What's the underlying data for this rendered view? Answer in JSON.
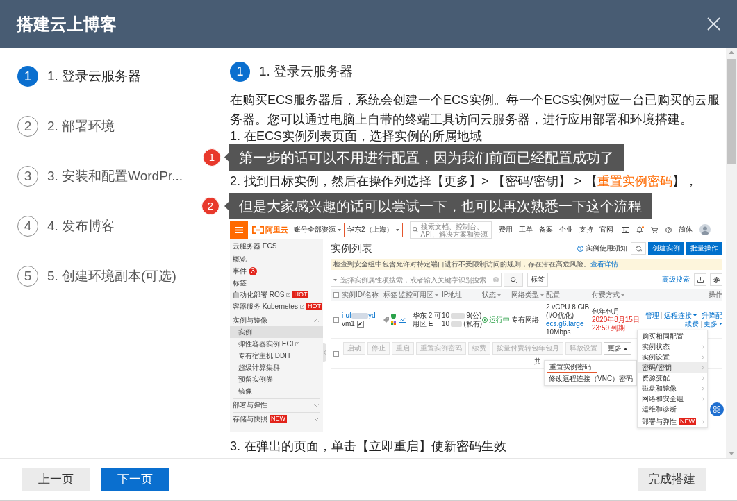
{
  "dialog": {
    "title": "搭建云上博客"
  },
  "steps": [
    {
      "number": "1",
      "label": "1. 登录云服务器",
      "selected": true
    },
    {
      "number": "2",
      "label": "2. 部署环境",
      "selected": false
    },
    {
      "number": "3",
      "label": "3. 安装和配置WordPr...",
      "selected": false
    },
    {
      "number": "4",
      "label": "4. 发布博客",
      "selected": false
    },
    {
      "number": "5",
      "label": "5. 创建环境副本(可选)",
      "selected": false
    }
  ],
  "content": {
    "heading": {
      "number": "1",
      "title": "1. 登录云服务器"
    },
    "intro": "在购买ECS服务器后，系统会创建一个ECS实例。每一个ECS实例对应一台已购买的云服务器。您可以通过电脑上自带的终端工具访问云服务器，进行应用部署和环境搭建。",
    "instructions": [
      {
        "kind": "text",
        "text": "1. 在ECS实例列表页面，选择实例的所属地域"
      },
      {
        "kind": "link",
        "before": "2. 找到目标实例，然后在操作列选择【更多】> 【密码/密钥】 > 【",
        "link": "重置实例密码",
        "after": "】，"
      }
    ],
    "screenshot": {
      "topbar": {
        "logo_text": "阿里云",
        "account_menu": "账号全部资源",
        "region": {
          "label": "华东2（上海）",
          "highlighted": true
        },
        "search_placeholder": "搜索文档、控制台、API、解决方案和资源",
        "links": [
          "费用",
          "工单",
          "备案",
          "企业",
          "支持",
          "官网"
        ],
        "notification_dot": true,
        "language": "简体"
      },
      "sidebar": {
        "title": "云服务器 ECS",
        "items": [
          {
            "kind": "item",
            "label": "概览",
            "selected": false
          },
          {
            "kind": "item",
            "label": "事件",
            "badge": "3",
            "selected": false
          },
          {
            "kind": "item",
            "label": "标签",
            "selected": false
          },
          {
            "kind": "item",
            "label": "自动化部署 ROS",
            "external": true,
            "tag": "HOT",
            "selected": false
          },
          {
            "kind": "item",
            "label": "容器服务 Kubernetes",
            "external": true,
            "tag": "HOT",
            "selected": false
          },
          {
            "kind": "group",
            "label": "实例与镜像",
            "expanded": true,
            "children": [
              {
                "label": "实例",
                "selected": true
              },
              {
                "label": "弹性容器实例 ECI",
                "external": true,
                "selected": false
              },
              {
                "label": "专有宿主机 DDH",
                "selected": false
              },
              {
                "label": "超级计算集群",
                "selected": false
              },
              {
                "label": "预留实例券",
                "selected": false
              },
              {
                "label": "镜像",
                "selected": false
              }
            ]
          },
          {
            "kind": "group",
            "label": "部署与弹性",
            "expanded": false
          },
          {
            "kind": "group",
            "label": "存储与快照",
            "expanded": false,
            "tag": "NEW"
          }
        ]
      },
      "page_title": "实例列表",
      "help_link": "实例使用须知",
      "header_buttons": [
        "创建实例",
        "批量操作"
      ],
      "alert": {
        "text": "检查到安全组中包含允许对特定端口进行不受限制访问的规则，存在潜在高危风险。",
        "link": "查看详情"
      },
      "filter": {
        "placeholder": "选择实例属性项搜索，或者输入关键字识别搜索",
        "tag_button": "标签",
        "advanced_link": "高级搜索"
      },
      "table": {
        "select_all_checked": false,
        "columns": [
          {
            "label": "实例ID/名称",
            "filter": false
          },
          {
            "label": "标签",
            "filter": false
          },
          {
            "label": "监控",
            "filter": false
          },
          {
            "label": "可用区",
            "filter": true
          },
          {
            "label": "IP地址",
            "filter": false
          },
          {
            "label": "状态",
            "filter": true
          },
          {
            "label": "网络类型",
            "filter": true
          },
          {
            "label": "配置",
            "filter": false
          },
          {
            "label": "付费方式",
            "filter": true
          },
          {
            "label": "操作",
            "filter": false
          }
        ],
        "rows": [
          {
            "checked": false,
            "id_start": "i-uf",
            "id_end": "yd",
            "name": "vm1",
            "zone": "华东 2 可用区 E",
            "ip": [
              {
                "start": "10",
                "end": "9(公)"
              },
              {
                "start": "10",
                "end": "(私有)"
              }
            ],
            "status": "运行中",
            "network": "专有网络",
            "config": {
              "spec": "2 vCPU 8 GiB",
              "io": "(I/O优化)",
              "type": "ecs.g6.large",
              "bandwidth": "10Mbps"
            },
            "billing": "包年包月",
            "expiry": [
              "2020年8月15日",
              "23:59 到期"
            ],
            "operations": [
              {
                "links": [
                  {
                    "label": "管理",
                    "dropdown": false
                  },
                  {
                    "label": "远程连接",
                    "dropdown": true
                  },
                  {
                    "label": "升降配",
                    "dropdown": false
                  }
                ]
              },
              {
                "links": [
                  {
                    "label": "续费",
                    "dropdown": false
                  },
                  {
                    "label": "更多",
                    "dropdown": true
                  }
                ]
              }
            ]
          }
        ]
      },
      "bulk": {
        "checked": false,
        "buttons": [
          {
            "label": "启动",
            "disabled": true
          },
          {
            "label": "停止",
            "disabled": true
          },
          {
            "label": "重启",
            "disabled": true
          },
          {
            "label": "重置实例密码",
            "disabled": true
          },
          {
            "label": "续费",
            "disabled": true
          },
          {
            "label": "按量付费转包年包月",
            "disabled": true
          },
          {
            "label": "释放设置",
            "disabled": true
          },
          {
            "label": "更多",
            "disabled": false,
            "dropdown": true
          }
        ],
        "total": "共"
      },
      "submenu": [
        {
          "label": "重置实例密码",
          "highlighted": true
        },
        {
          "label": "修改远程连接（VNC）密码",
          "highlighted": false
        }
      ],
      "menu": [
        {
          "label": "购买相同配置",
          "submenu": false,
          "selected": false
        },
        {
          "label": "实例状态",
          "submenu": true,
          "selected": false
        },
        {
          "label": "实例设置",
          "submenu": true,
          "selected": false
        },
        {
          "label": "密码/密钥",
          "submenu": true,
          "selected": true
        },
        {
          "label": "资源变配",
          "submenu": true,
          "selected": false
        },
        {
          "label": "磁盘和镜像",
          "submenu": true,
          "selected": false
        },
        {
          "label": "网络和安全组",
          "submenu": true,
          "selected": false
        },
        {
          "label": "运维和诊断",
          "submenu": false,
          "selected": false
        },
        {
          "label": "部署与弹性",
          "submenu": true,
          "badge": "NEW",
          "selected": false
        }
      ]
    },
    "closing": "3. 在弹出的页面，单击【立即重启】使新密码生效"
  },
  "notes": [
    {
      "number": "1",
      "text": "第一步的话可以不用进行配置，因为我们前面已经配置成功了"
    },
    {
      "number": "2",
      "text": "但是大家感兴趣的话可以尝试一下，也可以再次熟悉一下这个流程"
    }
  ],
  "footer": {
    "left_buttons": [
      {
        "label": "上一页",
        "kind": "secondary"
      },
      {
        "label": "下一页",
        "kind": "primary"
      }
    ],
    "right_buttons": [
      {
        "label": "完成搭建",
        "kind": "secondary"
      }
    ]
  }
}
